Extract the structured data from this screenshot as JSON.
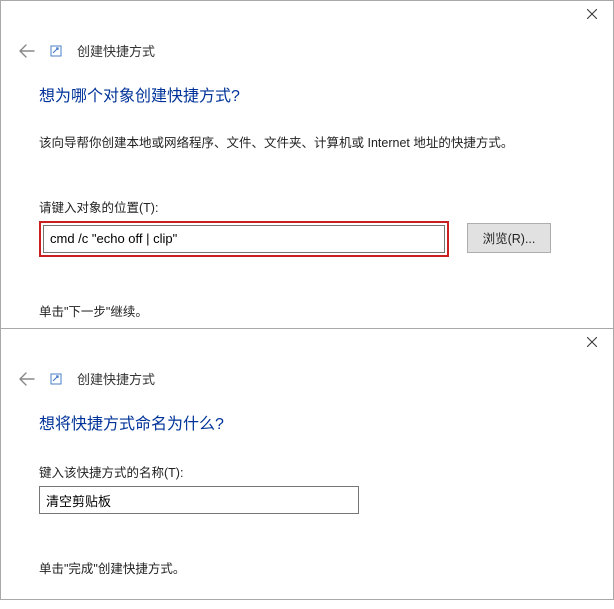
{
  "dialog1": {
    "wizard_title": "创建快捷方式",
    "heading": "想为哪个对象创建快捷方式?",
    "description": "该向导帮你创建本地或网络程序、文件、文件夹、计算机或 Internet 地址的快捷方式。",
    "location_label": "请键入对象的位置(T):",
    "location_value": "cmd /c \"echo off | clip\"",
    "browse_label": "浏览(R)...",
    "instruction": "单击\"下一步\"继续。"
  },
  "dialog2": {
    "wizard_title": "创建快捷方式",
    "heading": "想将快捷方式命名为什么?",
    "name_label": "键入该快捷方式的名称(T):",
    "name_value": "清空剪贴板",
    "instruction": "单击\"完成\"创建快捷方式。"
  }
}
